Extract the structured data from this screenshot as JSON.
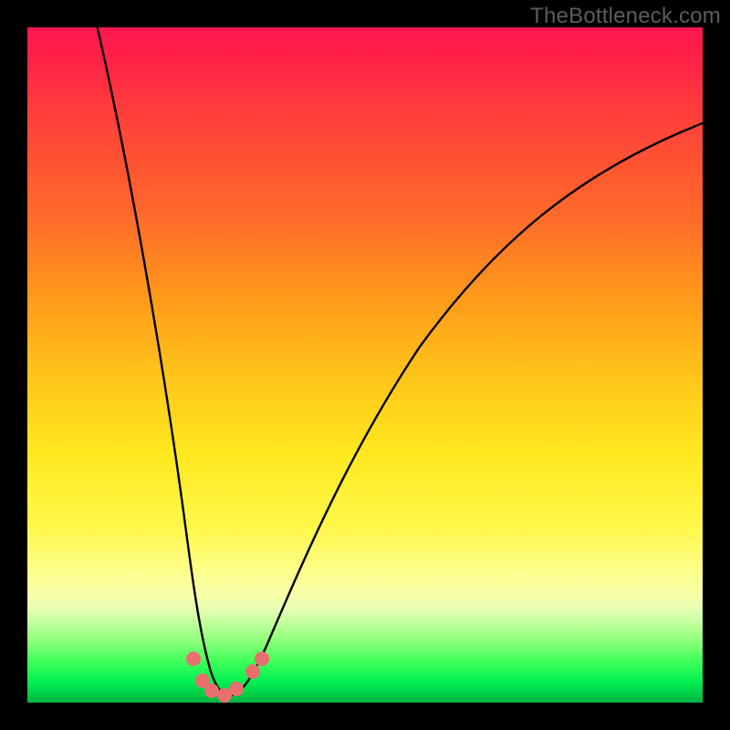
{
  "watermark": "TheBottleneck.com",
  "chart_data": {
    "type": "line",
    "title": "",
    "xlabel": "",
    "ylabel": "",
    "xlim": [
      0,
      100
    ],
    "ylim": [
      0,
      100
    ],
    "grid": false,
    "legend": false,
    "x": [
      10,
      12.5,
      15,
      17.5,
      20,
      22.5,
      23.5,
      24.5,
      25.5,
      26.5,
      27.5,
      28.5,
      30,
      32.5,
      35,
      40,
      45,
      50,
      55,
      60,
      65,
      70,
      75,
      80,
      85,
      90,
      95,
      100
    ],
    "bottleneck_pct": [
      100,
      87,
      74,
      61,
      46,
      30,
      22,
      14,
      8,
      4,
      2,
      1,
      0,
      1,
      3,
      10,
      19,
      28,
      36,
      44,
      51,
      57,
      63,
      68,
      72,
      76,
      79,
      82
    ],
    "optimal_x": 29,
    "markers_x": [
      24.4,
      25.8,
      27.2,
      29,
      30.8,
      33.2,
      34.6
    ],
    "markers_y": [
      6.8,
      3.2,
      1.5,
      0.8,
      1.8,
      4.6,
      6.8
    ],
    "series": [
      {
        "name": "bottleneck-curve",
        "color": "#000000"
      },
      {
        "name": "optimal-band-markers",
        "color": "#e96f6f"
      }
    ],
    "gradient_stops": [
      {
        "pos": 0,
        "color": "#ff1650"
      },
      {
        "pos": 28,
        "color": "#ff6a2a"
      },
      {
        "pos": 52,
        "color": "#ffc61a"
      },
      {
        "pos": 74,
        "color": "#fff84a"
      },
      {
        "pos": 88,
        "color": "#c6ff9f"
      },
      {
        "pos": 100,
        "color": "#00b341"
      }
    ]
  }
}
